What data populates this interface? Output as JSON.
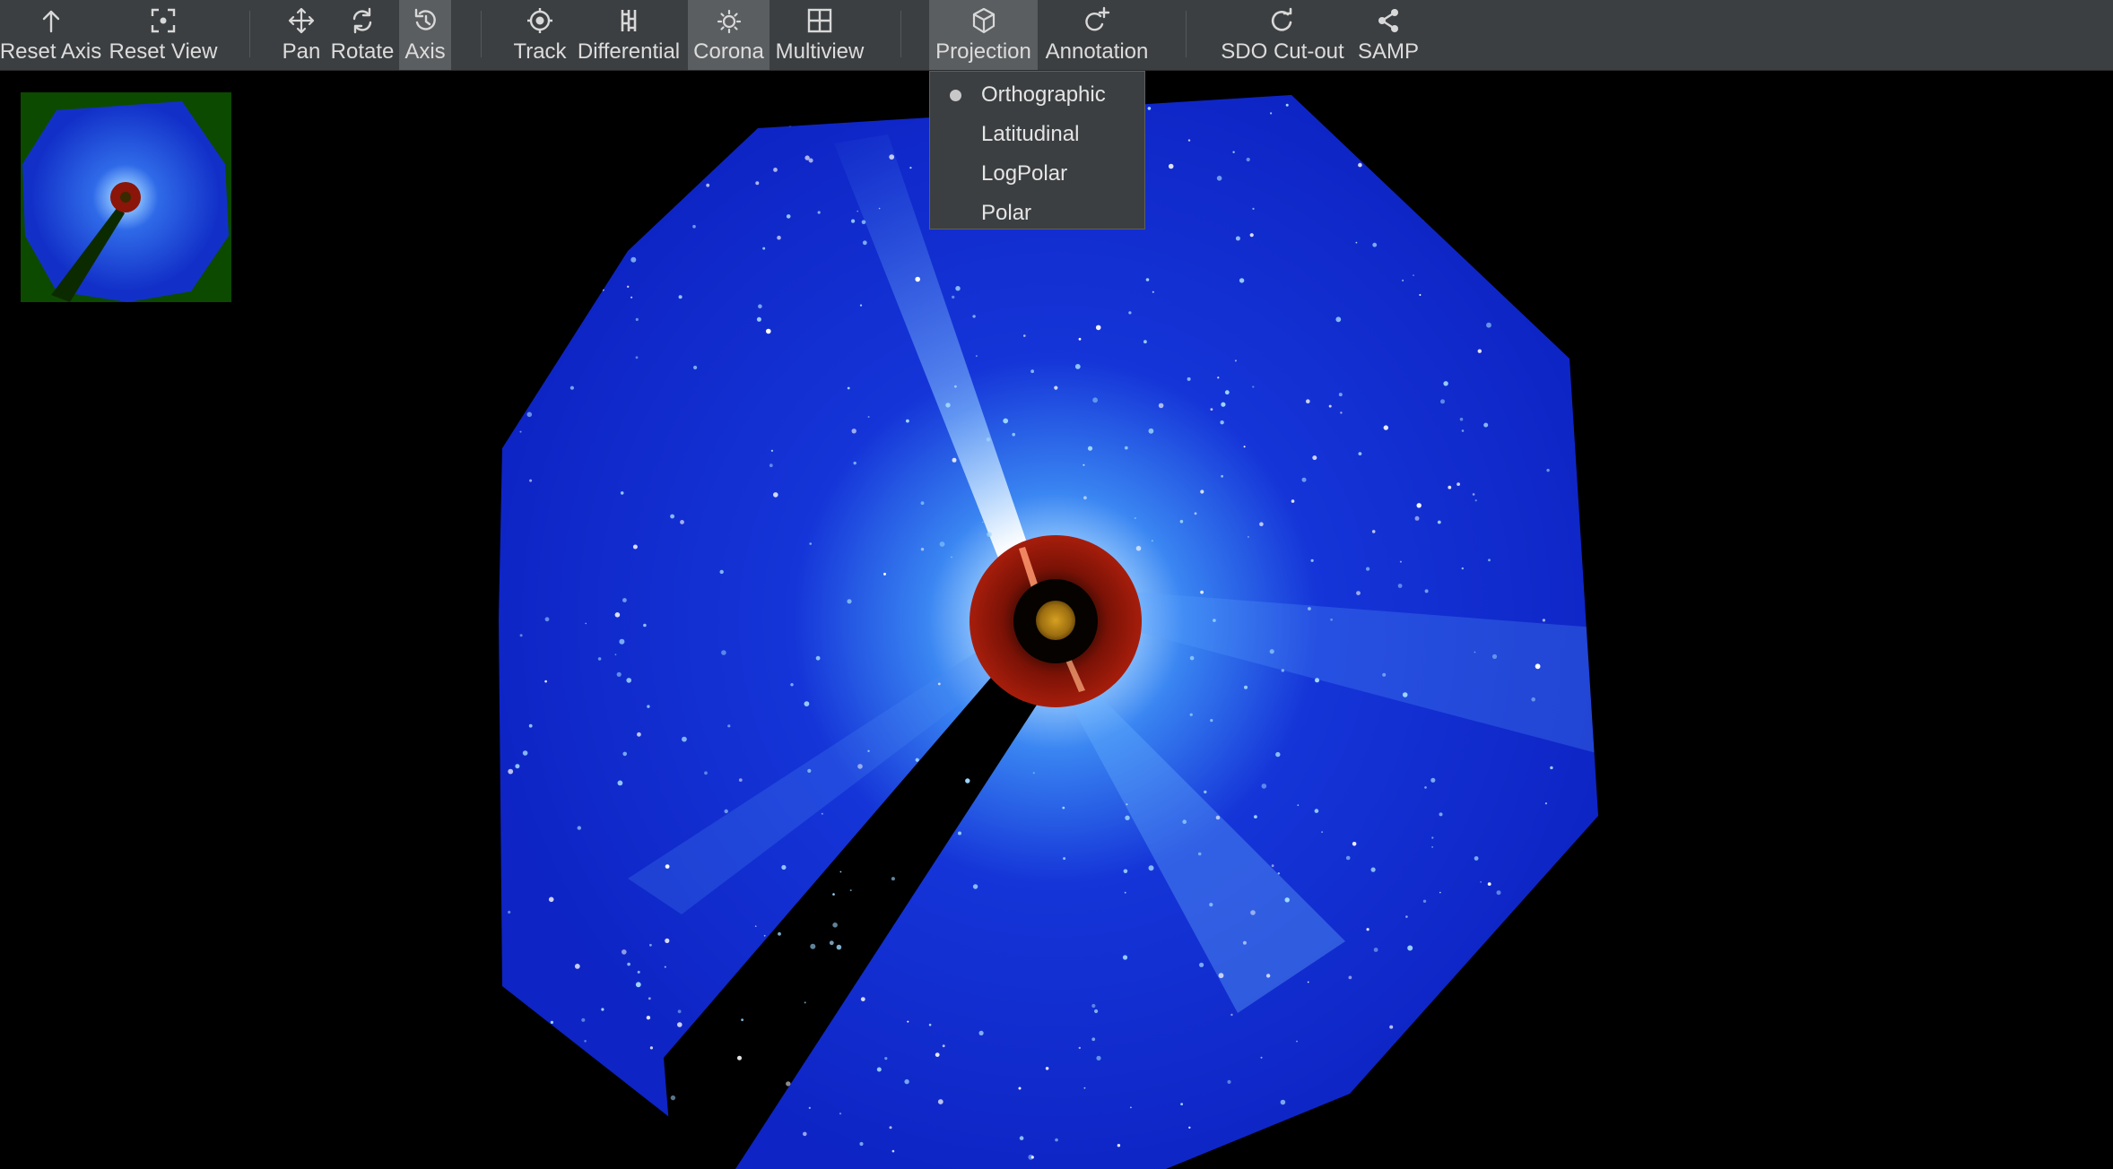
{
  "toolbar": {
    "reset_axis": "Reset Axis",
    "reset_view": "Reset View",
    "pan": "Pan",
    "rotate": "Rotate",
    "axis": "Axis",
    "track": "Track",
    "differential": "Differential",
    "corona": "Corona",
    "multiview": "Multiview",
    "projection": "Projection",
    "annotation": "Annotation",
    "sdo_cutout": "SDO Cut-out",
    "samp": "SAMP"
  },
  "projection_menu": {
    "selected": "Orthographic",
    "items": [
      "Orthographic",
      "Latitudinal",
      "LogPolar",
      "Polar"
    ]
  },
  "colors": {
    "toolbar_bg": "#3c3f41",
    "active_button": "#5b5e60",
    "coronagraph_blue": "#1a2fd0",
    "occulter_red": "#8a1508",
    "thumbnail_bg": "#0c4a00"
  }
}
